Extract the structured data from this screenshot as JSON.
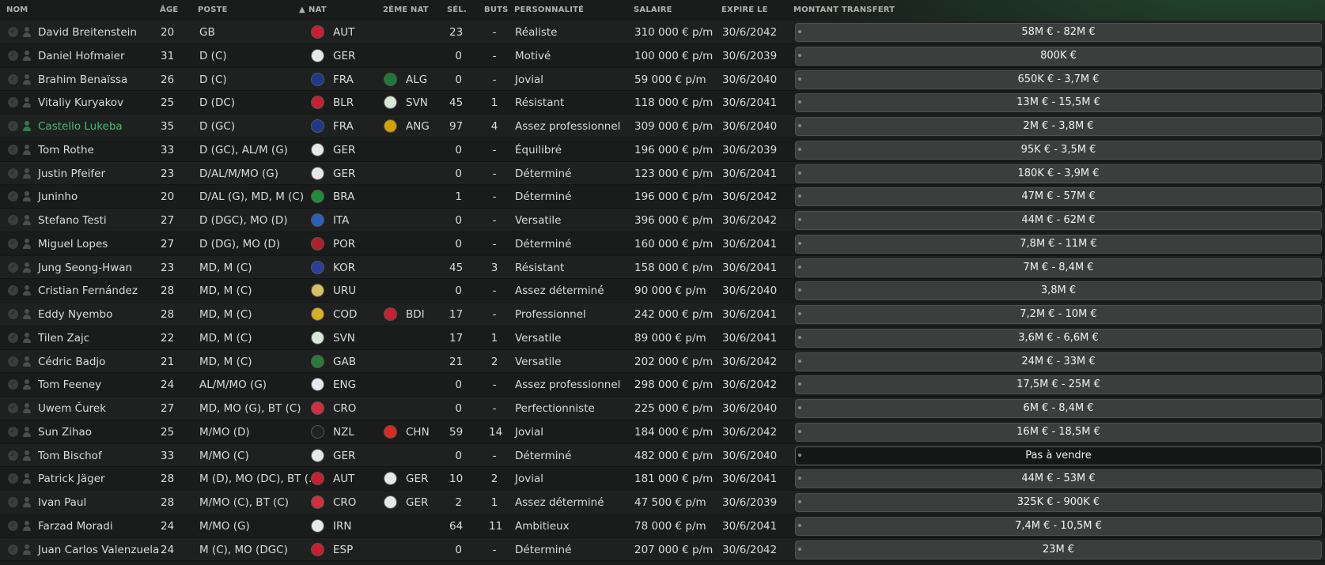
{
  "headers": {
    "name": "NOM",
    "age": "ÂGE",
    "position": "POSTE",
    "nat": "NAT",
    "second_nat": "2ÈME NAT",
    "caps": "SÉL.",
    "goals": "BUTS",
    "personality": "PERSONNALITÉ",
    "wage": "SALAIRE",
    "expires": "EXPIRE LE",
    "transfer": "MONTANT TRANSFERT"
  },
  "colors": {
    "highlight_name": "#3fbf6a",
    "transfer_bar": "#3a3f3d",
    "background": "#1a1c1b"
  },
  "players": [
    {
      "name": "David Breitenstein",
      "age": "20",
      "position": "GB",
      "nat": "AUT",
      "nat_color": "#c8202f",
      "second_nat": "",
      "second_nat_color": "",
      "caps": "23",
      "goals": "-",
      "personality": "Réaliste",
      "wage": "310 000 € p/m",
      "expires": "30/6/2042",
      "transfer": "58M € - 82M €"
    },
    {
      "name": "Daniel Hofmaier",
      "age": "31",
      "position": "D (C)",
      "nat": "GER",
      "nat_color": "#e8e8e8",
      "second_nat": "",
      "second_nat_color": "",
      "caps": "0",
      "goals": "-",
      "personality": "Motivé",
      "wage": "100 000 € p/m",
      "expires": "30/6/2039",
      "transfer": "800K €"
    },
    {
      "name": "Brahim Benaïssa",
      "age": "26",
      "position": "D (C)",
      "nat": "FRA",
      "nat_color": "#1d3a8a",
      "second_nat": "ALG",
      "second_nat_color": "#1f7a3a",
      "caps": "0",
      "goals": "-",
      "personality": "Jovial",
      "wage": "59 000 € p/m",
      "expires": "30/6/2040",
      "transfer": "650K € - 3,7M €"
    },
    {
      "name": "Vitaliy Kuryakov",
      "age": "25",
      "position": "D (DC)",
      "nat": "BLR",
      "nat_color": "#c8202f",
      "second_nat": "SVN",
      "second_nat_color": "#d8e8d8",
      "caps": "45",
      "goals": "1",
      "personality": "Résistant",
      "wage": "118 000 € p/m",
      "expires": "30/6/2041",
      "transfer": "13M € - 15,5M €"
    },
    {
      "name": "Castello Lukeba",
      "age": "35",
      "position": "D (GC)",
      "nat": "FRA",
      "nat_color": "#1d3a8a",
      "second_nat": "ANG",
      "second_nat_color": "#d4a000",
      "caps": "97",
      "goals": "4",
      "personality": "Assez professionnel",
      "wage": "309 000 € p/m",
      "expires": "30/6/2040",
      "transfer": "2M € - 3,8M €",
      "highlight": true
    },
    {
      "name": "Tom Rothe",
      "age": "33",
      "position": "D (GC), AL/M (G)",
      "nat": "GER",
      "nat_color": "#e8e8e8",
      "second_nat": "",
      "second_nat_color": "",
      "caps": "0",
      "goals": "-",
      "personality": "Équilibré",
      "wage": "196 000 € p/m",
      "expires": "30/6/2039",
      "transfer": "95K € - 3,5M €"
    },
    {
      "name": "Justin Pfeifer",
      "age": "23",
      "position": "D/AL/M/MO (G)",
      "nat": "GER",
      "nat_color": "#e8e8e8",
      "second_nat": "",
      "second_nat_color": "",
      "caps": "0",
      "goals": "-",
      "personality": "Déterminé",
      "wage": "123 000 € p/m",
      "expires": "30/6/2041",
      "transfer": "180K € - 3,9M €"
    },
    {
      "name": "Juninho",
      "age": "20",
      "position": "D/AL (G), MD, M (C)",
      "nat": "BRA",
      "nat_color": "#1f8a3a",
      "second_nat": "",
      "second_nat_color": "",
      "caps": "1",
      "goals": "-",
      "personality": "Déterminé",
      "wage": "196 000 € p/m",
      "expires": "30/6/2042",
      "transfer": "47M € - 57M €"
    },
    {
      "name": "Stefano Testi",
      "age": "27",
      "position": "D (DGC), MO (D)",
      "nat": "ITA",
      "nat_color": "#2a5fbf",
      "second_nat": "",
      "second_nat_color": "",
      "caps": "0",
      "goals": "-",
      "personality": "Versatile",
      "wage": "396 000 € p/m",
      "expires": "30/6/2042",
      "transfer": "44M € - 62M €"
    },
    {
      "name": "Miguel Lopes",
      "age": "27",
      "position": "D (DG), MO (D)",
      "nat": "POR",
      "nat_color": "#b01e2a",
      "second_nat": "",
      "second_nat_color": "",
      "caps": "0",
      "goals": "-",
      "personality": "Déterminé",
      "wage": "160 000 € p/m",
      "expires": "30/6/2041",
      "transfer": "7,8M € - 11M €"
    },
    {
      "name": "Jung Seong-Hwan",
      "age": "23",
      "position": "MD, M (C)",
      "nat": "KOR",
      "nat_color": "#2a3f9a",
      "second_nat": "",
      "second_nat_color": "",
      "caps": "45",
      "goals": "3",
      "personality": "Résistant",
      "wage": "158 000 € p/m",
      "expires": "30/6/2041",
      "transfer": "7M € - 8,4M €"
    },
    {
      "name": "Cristian Fernández",
      "age": "28",
      "position": "MD, M (C)",
      "nat": "URU",
      "nat_color": "#d8c060",
      "second_nat": "",
      "second_nat_color": "",
      "caps": "0",
      "goals": "-",
      "personality": "Assez déterminé",
      "wage": "90 000 € p/m",
      "expires": "30/6/2040",
      "transfer": "3,8M €"
    },
    {
      "name": "Eddy Nyembo",
      "age": "28",
      "position": "MD, M (C)",
      "nat": "COD",
      "nat_color": "#d8b020",
      "second_nat": "BDI",
      "second_nat_color": "#c8202f",
      "caps": "17",
      "goals": "-",
      "personality": "Professionnel",
      "wage": "242 000 € p/m",
      "expires": "30/6/2041",
      "transfer": "7,2M € - 10M €"
    },
    {
      "name": "Tilen Zajc",
      "age": "22",
      "position": "MD, M (C)",
      "nat": "SVN",
      "nat_color": "#d8e8d8",
      "second_nat": "",
      "second_nat_color": "",
      "caps": "17",
      "goals": "1",
      "personality": "Versatile",
      "wage": "89 000 € p/m",
      "expires": "30/6/2041",
      "transfer": "3,6M € - 6,6M €"
    },
    {
      "name": "Cédric Badjo",
      "age": "21",
      "position": "MD, M (C)",
      "nat": "GAB",
      "nat_color": "#2a7a3a",
      "second_nat": "",
      "second_nat_color": "",
      "caps": "21",
      "goals": "2",
      "personality": "Versatile",
      "wage": "202 000 € p/m",
      "expires": "30/6/2042",
      "transfer": "24M € - 33M €"
    },
    {
      "name": "Tom Feeney",
      "age": "24",
      "position": "AL/M/MO (G)",
      "nat": "ENG",
      "nat_color": "#e8e8f0",
      "second_nat": "",
      "second_nat_color": "",
      "caps": "0",
      "goals": "-",
      "personality": "Assez professionnel",
      "wage": "298 000 € p/m",
      "expires": "30/6/2042",
      "transfer": "17,5M € - 25M €"
    },
    {
      "name": "Uwem Čurek",
      "age": "27",
      "position": "MD, MO (G), BT (C)",
      "nat": "CRO",
      "nat_color": "#d03040",
      "second_nat": "",
      "second_nat_color": "",
      "caps": "0",
      "goals": "-",
      "personality": "Perfectionniste",
      "wage": "225 000 € p/m",
      "expires": "30/6/2040",
      "transfer": "6M € - 8,4M €"
    },
    {
      "name": "Sun Zihao",
      "age": "25",
      "position": "M/MO (D)",
      "nat": "NZL",
      "nat_color": "#222222",
      "second_nat": "CHN",
      "second_nat_color": "#d82a20",
      "caps": "59",
      "goals": "14",
      "personality": "Jovial",
      "wage": "184 000 € p/m",
      "expires": "30/6/2042",
      "transfer": "16M € - 18,5M €"
    },
    {
      "name": "Tom Bischof",
      "age": "33",
      "position": "M/MO (C)",
      "nat": "GER",
      "nat_color": "#e8e8e8",
      "second_nat": "",
      "second_nat_color": "",
      "caps": "0",
      "goals": "-",
      "personality": "Déterminé",
      "wage": "482 000 € p/m",
      "expires": "30/6/2040",
      "transfer": "Pas à vendre",
      "not_for_sale": true
    },
    {
      "name": "Patrick Jäger",
      "age": "28",
      "position": "M (D), MO (DC), BT (...",
      "nat": "AUT",
      "nat_color": "#c8202f",
      "second_nat": "GER",
      "second_nat_color": "#e8e8e8",
      "caps": "10",
      "goals": "2",
      "personality": "Jovial",
      "wage": "181 000 € p/m",
      "expires": "30/6/2041",
      "transfer": "44M € - 53M €"
    },
    {
      "name": "Ivan Paul",
      "age": "28",
      "position": "M/MO (C), BT (C)",
      "nat": "CRO",
      "nat_color": "#d03040",
      "second_nat": "GER",
      "second_nat_color": "#e8e8e8",
      "caps": "2",
      "goals": "1",
      "personality": "Assez déterminé",
      "wage": "47 500 € p/m",
      "expires": "30/6/2039",
      "transfer": "325K € - 900K €"
    },
    {
      "name": "Farzad Moradi",
      "age": "24",
      "position": "M/MO (G)",
      "nat": "IRN",
      "nat_color": "#e8e8e8",
      "second_nat": "",
      "second_nat_color": "",
      "caps": "64",
      "goals": "11",
      "personality": "Ambitieux",
      "wage": "78 000 € p/m",
      "expires": "30/6/2041",
      "transfer": "7,4M € - 10,5M €"
    },
    {
      "name": "Juan Carlos Valenzuela",
      "age": "24",
      "position": "M (C), MO (DGC)",
      "nat": "ESP",
      "nat_color": "#c8202f",
      "second_nat": "",
      "second_nat_color": "",
      "caps": "0",
      "goals": "-",
      "personality": "Déterminé",
      "wage": "207 000 € p/m",
      "expires": "30/6/2042",
      "transfer": "23M €"
    }
  ]
}
